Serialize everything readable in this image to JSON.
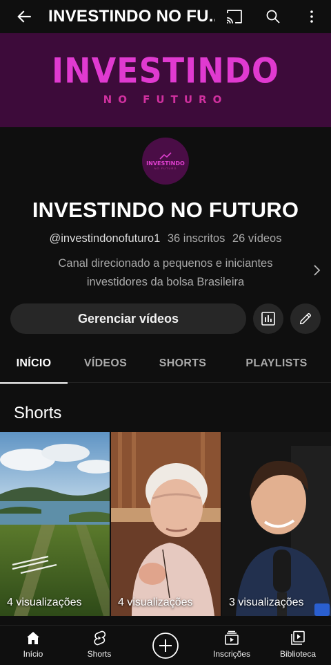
{
  "topbar": {
    "title": "INVESTINDO NO FU...",
    "icons": [
      "back-arrow-icon",
      "cast-icon",
      "search-icon",
      "more-vertical-icon"
    ]
  },
  "banner": {
    "title": "INVESTINDO",
    "subtitle": "NO FUTURO",
    "color": "#e03ad0",
    "background": "#3d0b3a"
  },
  "avatar": {
    "text": "INVESTINDO",
    "subtext": "NO FUTURO"
  },
  "channel": {
    "name": "INVESTINDO NO FUTURO",
    "handle": "@investindonofuturo1",
    "subscribers": "36 inscritos",
    "videos": "26 vídeos",
    "description_line1": "Canal direcionado a pequenos e iniciantes",
    "description_line2": "investidores da bolsa Brasileira"
  },
  "actions": {
    "manage_label": "Gerenciar vídeos",
    "analytics_icon": "analytics-icon",
    "edit_icon": "pencil-icon"
  },
  "tabs": [
    {
      "label": "INÍCIO",
      "active": true
    },
    {
      "label": "VÍDEOS",
      "active": false
    },
    {
      "label": "SHORTS",
      "active": false
    },
    {
      "label": "PLAYLISTS",
      "active": false
    }
  ],
  "shorts_section": {
    "title": "Shorts",
    "items": [
      {
        "views": "4 visualizações"
      },
      {
        "views": "4 visualizações"
      },
      {
        "views": "3 visualizações"
      }
    ]
  },
  "bottom_nav": [
    {
      "label": "Início",
      "icon": "home-icon"
    },
    {
      "label": "Shorts",
      "icon": "shorts-icon"
    },
    {
      "label": "",
      "icon": "create-plus-icon"
    },
    {
      "label": "Inscrições",
      "icon": "subscriptions-icon"
    },
    {
      "label": "Biblioteca",
      "icon": "library-icon"
    }
  ]
}
